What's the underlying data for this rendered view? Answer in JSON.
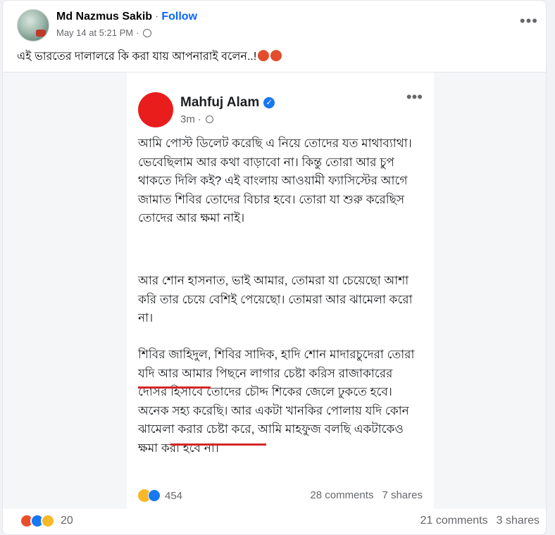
{
  "post": {
    "author": "Md Nazmus Sakib",
    "separator": "·",
    "follow_label": "Follow",
    "timestamp": "May 14 at 5:21 PM",
    "separator2": "·",
    "more_label": "•••",
    "caption": "এই ভারতের দালালরে কি করা যায় আপনারাই বলেন..!"
  },
  "shared_post": {
    "author": "Mahfuj Alam",
    "verified_mark": "✓",
    "time": "3m",
    "separator": "·",
    "more_label": "•••",
    "paragraph_1": "আমি পোস্ট ডিলেট করেছি এ নিয়ে তোদের যত মাথাব্যাথা। ভেবেছিলাম আর কথা বাড়াবো না। কিন্তু তোরা আর চুপ থাকতে দিলি কই? এই বাংলায় আওয়ামী ফ্যাসিস্টের আগে জামাত শিবির তোদের বিচার হবে। তোরা যা শুরু করেছিস তোদের আর ক্ষমা নাই।",
    "paragraph_2": "আর শোন হাসনাত, ভাই আমার, তোমরা যা চেয়েছো আশা করি তার চেয়ে বেশিই পেয়েছো। তোমরা আর ঝামেলা করো না।",
    "paragraph_3": "শিবির জাহিদুল, শিবির সাদিক, হাদি শোন মাদারচুদেরা তোরা যদি আর আমার পিছনে লাগার চেষ্টা করিস রাজাকারের দোসর হিসাবে তোদের চৌদ্দ শিকের জেলে ঢুকতে হবে। অনেক সহ্য করেছি। আর একটা খানকির পোলায় যদি কোন ঝামেলা করার চেষ্টা করে, আমি মাহফুজ বলছি একটাকেও ক্ষমা করা হবে না।",
    "reaction_count": "454",
    "comments": "28 comments",
    "shares": "7 shares"
  },
  "footer": {
    "reaction_count": "20",
    "comments": "21 comments",
    "shares": "3 shares"
  },
  "colors": {
    "accent": "#0866ff",
    "underline": "#d42626",
    "inner_avatar": "#ea1d1d"
  }
}
